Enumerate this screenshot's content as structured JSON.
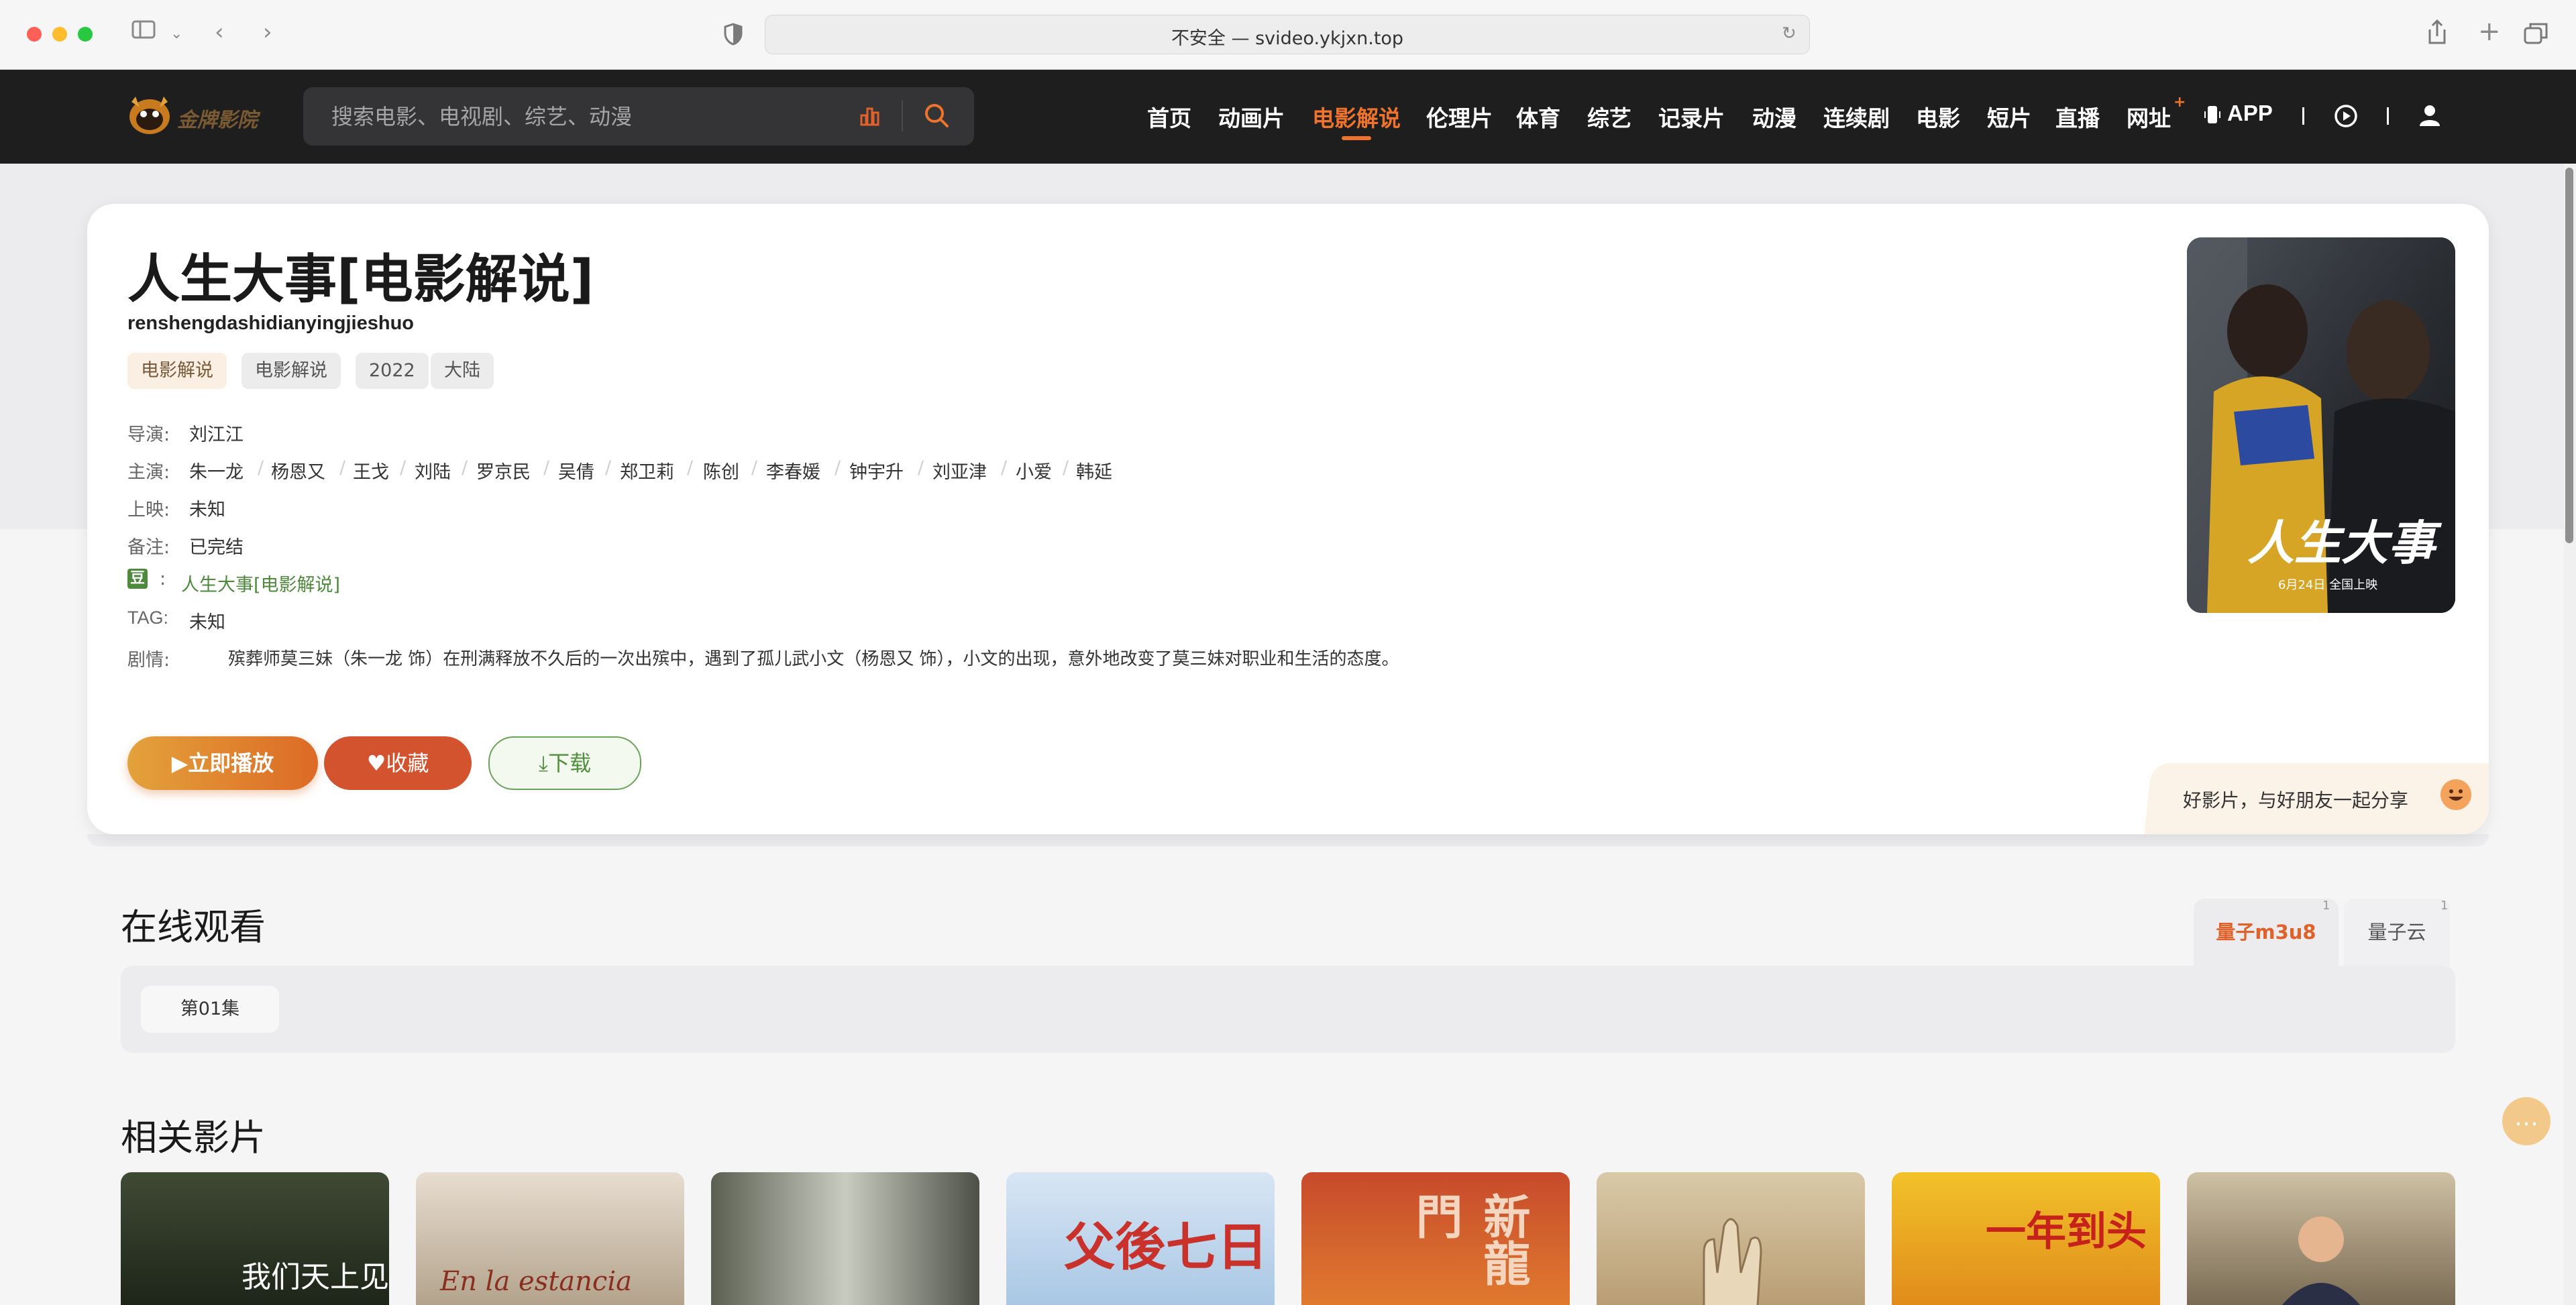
{
  "browser": {
    "url_display": "不安全 — svideo.ykjxn.top"
  },
  "site": {
    "logo_text": "金牌影院",
    "search_placeholder": "搜索电影、电视剧、综艺、动漫",
    "nav": [
      "首页",
      "动画片",
      "电影解说",
      "伦理片",
      "体育",
      "综艺",
      "记录片",
      "动漫",
      "连续剧",
      "电影",
      "短片",
      "直播",
      "网址",
      "APP"
    ],
    "nav_active": "电影解说",
    "nav_badge": "+",
    "accent_color": "#f0732b"
  },
  "detail": {
    "title": "人生大事[电影解说]",
    "pinyin": "renshengdashidianyingjieshuo",
    "tags": [
      "电影解说",
      "电影解说",
      "2022",
      "大陆"
    ],
    "director_label": "导演:",
    "director": "刘江江",
    "cast_label": "主演:",
    "cast": [
      "朱一龙",
      "杨恩又",
      "王戈",
      "刘陆",
      "罗京民",
      "吴倩",
      "郑卫莉",
      "陈创",
      "李春媛",
      "钟宇升",
      "刘亚津",
      "小爱",
      "韩延"
    ],
    "release_label": "上映:",
    "release": "未知",
    "note_label": "备注:",
    "note": "已完结",
    "douban_icon": "豆",
    "douban_sep": ":",
    "douban_link": "人生大事[电影解说]",
    "tag_label": "TAG:",
    "tag_value": "未知",
    "plot_label": "剧情:",
    "plot": "殡葬师莫三妹（朱一龙 饰）在刑满释放不久后的一次出殡中，遇到了孤儿武小文（杨恩又 饰），小文的出现，意外地改变了莫三妹对职业和生活的态度。",
    "btn_play": "立即播放",
    "btn_fav": "收藏",
    "btn_download": "下载",
    "share_text": "好影片，与好朋友一起分享",
    "poster_text": "人生大事",
    "poster_date": "6月24日 全国上映"
  },
  "online": {
    "title": "在线观看",
    "sources": [
      {
        "label": "量子m3u8",
        "count": "1",
        "active": true
      },
      {
        "label": "量子云",
        "count": "1",
        "active": false
      }
    ],
    "episodes": [
      "第01集"
    ]
  },
  "related": {
    "title": "相关影片",
    "thumb_texts": [
      "我们天上见",
      "En la estancia",
      "",
      "父後七日",
      "新龍門",
      "",
      "一年到头",
      ""
    ]
  }
}
